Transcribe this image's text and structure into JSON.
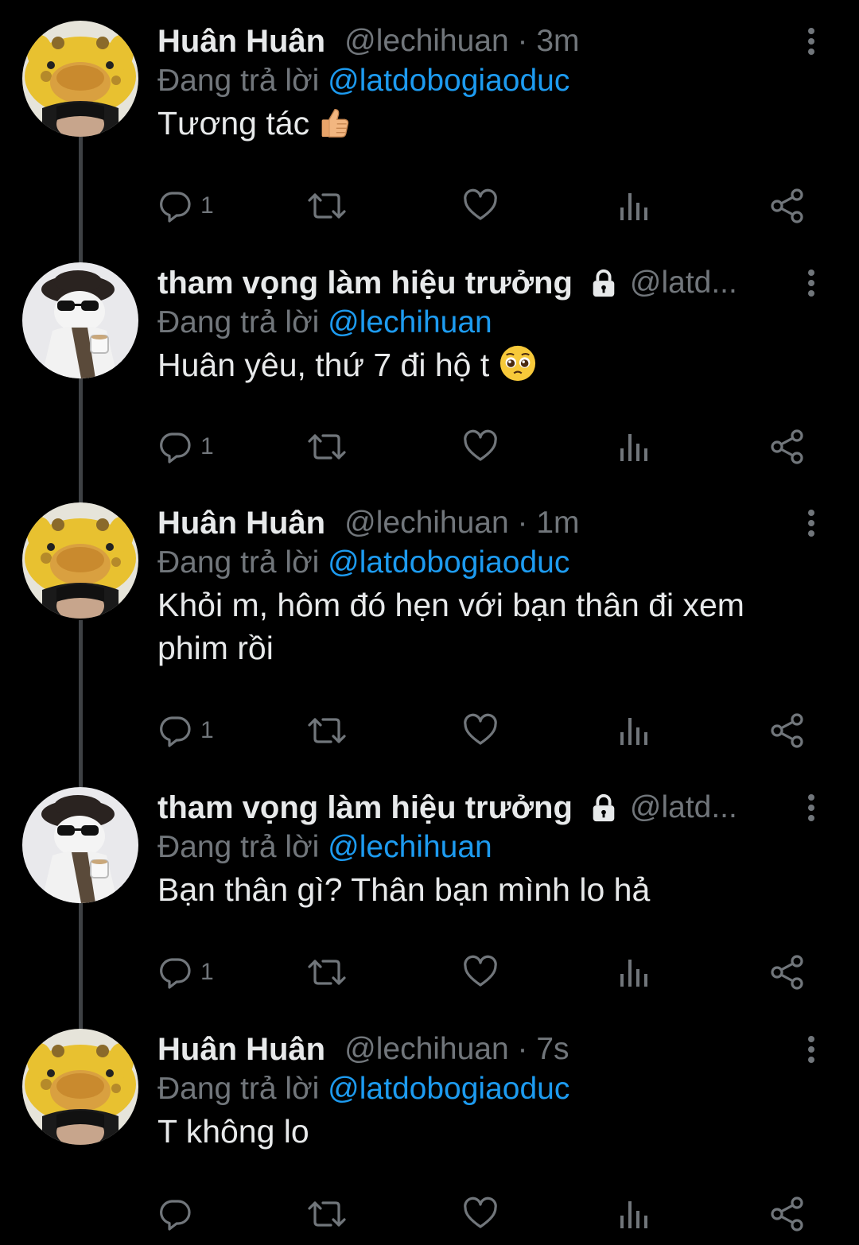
{
  "reply_prefix": "Đang trả lời",
  "tweets": [
    {
      "name": "Huân Huân",
      "handle": "@lechihuan · 3m",
      "reply_to": "@latdobogiaoduc",
      "text": "Tương tác",
      "emoji": "thumbs-up",
      "replies": "1",
      "avatar": "giraffe-hat"
    },
    {
      "name": "tham vọng làm hiệu trưởng",
      "handle": "@latd...",
      "locked": true,
      "reply_to": "@lechihuan",
      "text": "Huân yêu, thứ 7 đi hộ t",
      "emoji": "pleading-face",
      "replies": "1",
      "avatar": "beret-cat"
    },
    {
      "name": "Huân Huân",
      "handle": "@lechihuan · 1m",
      "reply_to": "@latdobogiaoduc",
      "text_line1": "Khỏi m, hôm đó hẹn với bạn thân đi xem",
      "text_line2": "phim rồi",
      "replies": "1",
      "avatar": "giraffe-hat"
    },
    {
      "name": "tham vọng làm hiệu trưởng",
      "handle": "@latd...",
      "locked": true,
      "reply_to": "@lechihuan",
      "text": "Bạn thân gì? Thân bạn mình lo hả",
      "replies": "1",
      "avatar": "beret-cat"
    },
    {
      "name": "Huân Huân",
      "handle": "@lechihuan · 7s",
      "reply_to": "@latdobogiaoduc",
      "text": "T không lo",
      "replies": "",
      "avatar": "giraffe-hat"
    }
  ],
  "colors": {
    "background": "#000000",
    "text": "#e7e9ea",
    "secondary": "#71767b",
    "mention": "#1d9bf0",
    "thread_line": "#3e4144"
  }
}
